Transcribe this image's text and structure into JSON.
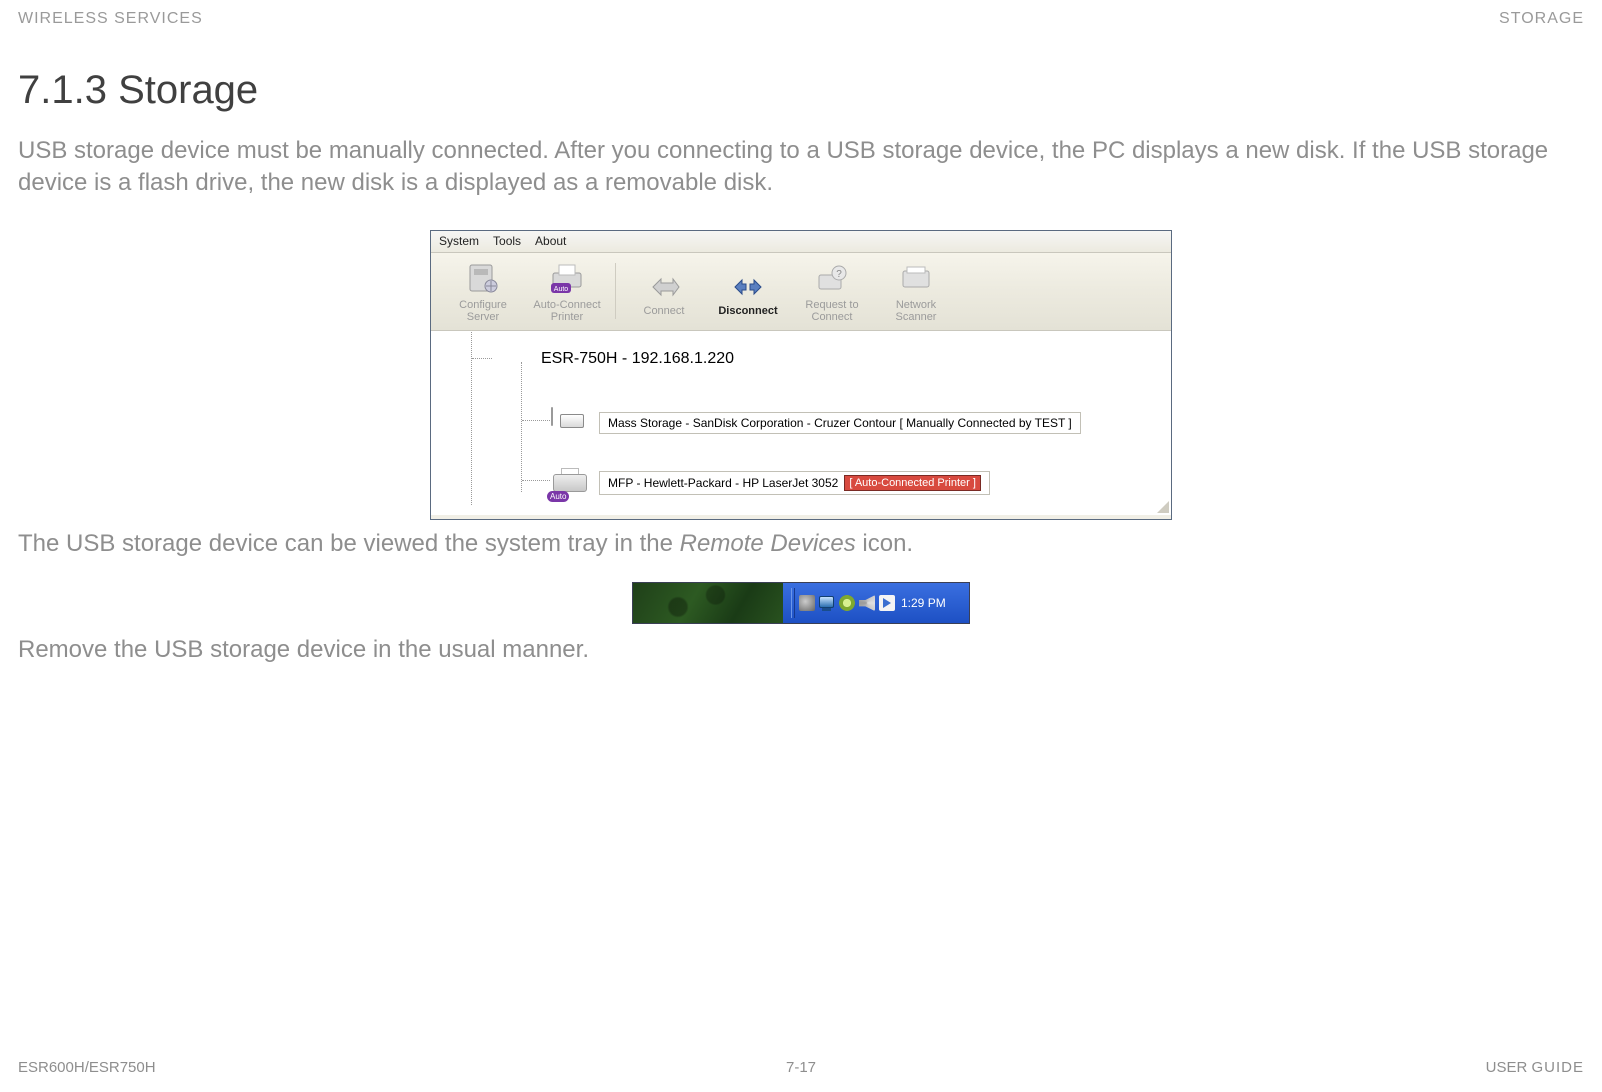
{
  "header": {
    "left": "WIRELESS SERVICES",
    "right": "STORAGE"
  },
  "section_title": "7.1.3 Storage",
  "para1": "USB storage device must be manually connected. After you connecting to a USB storage device, the PC displays a new disk. If the USB storage device is a flash drive, the new disk is a displayed as a removable disk.",
  "para2_pre": "The USB storage device can be viewed the system tray in the ",
  "para2_italic": "Remote Devices",
  "para2_post": " icon.",
  "para3": "Remove the USB storage device in the usual manner.",
  "app": {
    "menubar": {
      "system": "System",
      "tools": "Tools",
      "about": "About"
    },
    "toolbar": {
      "configure_server": "Configure\nServer",
      "auto_connect_printer": "Auto-Connect\nPrinter",
      "connect": "Connect",
      "disconnect": "Disconnect",
      "request_to_connect": "Request to\nConnect",
      "network_scanner": "Network\nScanner"
    },
    "tree": {
      "root_label": "ESR-750H - 192.168.1.220",
      "mass_storage_label": "Mass Storage - SanDisk Corporation - Cruzer Contour [ Manually Connected by TEST ]",
      "mfp_label": "MFP - Hewlett-Packard - HP LaserJet 3052",
      "mfp_badge": "[ Auto-Connected Printer ]",
      "auto_badge": "Auto"
    }
  },
  "tray": {
    "time": "1:29 PM"
  },
  "footer": {
    "left": "ESR600H/ESR750H",
    "center": "7-17",
    "right_user": "USER",
    "right_guide": "GUIDE"
  }
}
